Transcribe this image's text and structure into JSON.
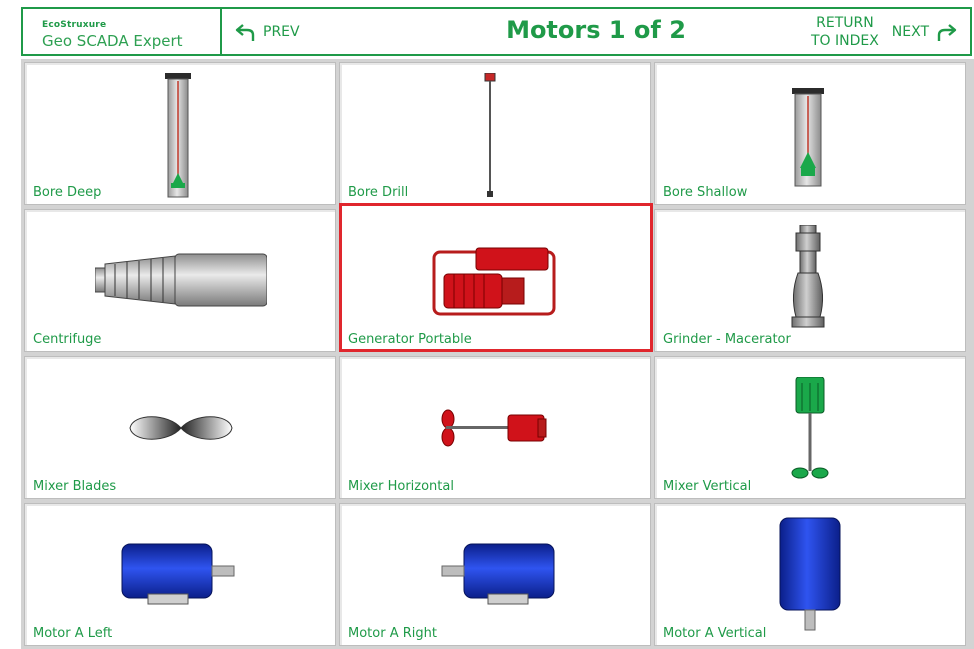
{
  "header": {
    "logo_top": "EcoStruxure",
    "logo_name": "Geo SCADA Expert",
    "prev_label": "PREV",
    "title": "Motors 1 of 2",
    "return_line1": "RETURN",
    "return_line2": "TO INDEX",
    "next_label": "NEXT"
  },
  "colors": {
    "accent": "#1f9a48",
    "selection": "#e0262d",
    "motor_blue": "#1433c9",
    "generator_red": "#d0121a"
  },
  "tiles": [
    {
      "label": "Bore Deep",
      "icon": "bore-deep-icon"
    },
    {
      "label": "Bore Drill",
      "icon": "bore-drill-icon"
    },
    {
      "label": "Bore Shallow",
      "icon": "bore-shallow-icon"
    },
    {
      "label": "Centrifuge",
      "icon": "centrifuge-icon"
    },
    {
      "label": "Generator Portable",
      "icon": "generator-portable-icon",
      "selected": true
    },
    {
      "label": "Grinder - Macerator",
      "icon": "grinder-macerator-icon"
    },
    {
      "label": "Mixer Blades",
      "icon": "mixer-blades-icon"
    },
    {
      "label": "Mixer Horizontal",
      "icon": "mixer-horizontal-icon"
    },
    {
      "label": "Mixer Vertical",
      "icon": "mixer-vertical-icon"
    },
    {
      "label": "Motor A Left",
      "icon": "motor-a-left-icon"
    },
    {
      "label": "Motor A Right",
      "icon": "motor-a-right-icon"
    },
    {
      "label": "Motor A Vertical",
      "icon": "motor-a-vertical-icon"
    }
  ]
}
